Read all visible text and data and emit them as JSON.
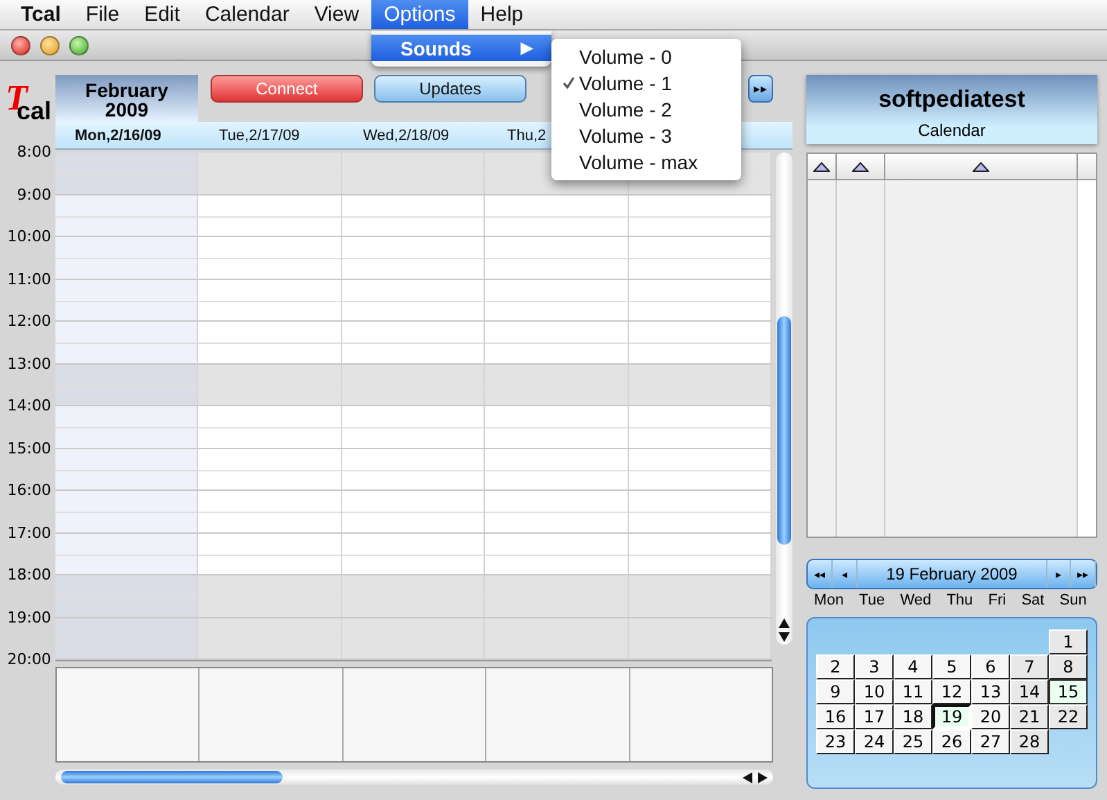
{
  "menu_bar": [
    {
      "label": "Tcal",
      "kind": "app",
      "selected": false
    },
    {
      "label": "File",
      "kind": "menu",
      "selected": false
    },
    {
      "label": "Edit",
      "kind": "menu",
      "selected": false
    },
    {
      "label": "Calendar",
      "kind": "menu",
      "selected": false
    },
    {
      "label": "View",
      "kind": "menu",
      "selected": false
    },
    {
      "label": "Options",
      "kind": "menu",
      "selected": true
    },
    {
      "label": "Help",
      "kind": "menu",
      "selected": false
    }
  ],
  "options_menu": {
    "items": [
      {
        "label": "Sounds",
        "arrow": "▶",
        "selected": true
      }
    ],
    "submenu": [
      {
        "label": "Volume - 0",
        "checked": false
      },
      {
        "label": "Volume - 1",
        "checked": true
      },
      {
        "label": "Volume - 2",
        "checked": false
      },
      {
        "label": "Volume - 3",
        "checked": false
      },
      {
        "label": "Volume - max",
        "checked": false
      }
    ]
  },
  "logo": {
    "letter": "T",
    "rest": "cal"
  },
  "month": {
    "name": "February",
    "year": "2009"
  },
  "toolbar": [
    {
      "label": "Connect",
      "kind": "red"
    },
    {
      "label": "Updates",
      "kind": "blue"
    }
  ],
  "next_button": "▸▸",
  "day_headers": [
    {
      "label": "Mon,2/16/09",
      "selected": true
    },
    {
      "label": "Tue,2/17/09",
      "selected": false
    },
    {
      "label": "Wed,2/18/09",
      "selected": false
    },
    {
      "label": "Thu,2",
      "selected": false
    }
  ],
  "hours": [
    {
      "label": "8:00",
      "shaded": true
    },
    {
      "label": "9:00",
      "shaded": false
    },
    {
      "label": "10:00",
      "shaded": false
    },
    {
      "label": "11:00",
      "shaded": false
    },
    {
      "label": "12:00",
      "shaded": false
    },
    {
      "label": "13:00",
      "shaded": true
    },
    {
      "label": "14:00",
      "shaded": false
    },
    {
      "label": "15:00",
      "shaded": false
    },
    {
      "label": "16:00",
      "shaded": false
    },
    {
      "label": "17:00",
      "shaded": false
    },
    {
      "label": "18:00",
      "shaded": true
    },
    {
      "label": "19:00",
      "shaded": true
    },
    {
      "label": "20:00"
    }
  ],
  "user": {
    "name": "softpediatest",
    "subtitle": "Calendar"
  },
  "mini_calendar": {
    "title": "19 February 2009",
    "prev_year": "◂◂",
    "prev": "◂",
    "next": "▸",
    "next_year": "▸▸",
    "weekdays": [
      "Mon",
      "Tue",
      "Wed",
      "Thu",
      "Fri",
      "Sat",
      "Sun"
    ],
    "weeks": [
      [
        {
          "day": "1",
          "selected": false,
          "today": false
        }
      ],
      [
        {
          "day": "2",
          "selected": false,
          "today": false
        },
        {
          "day": "3",
          "selected": false,
          "today": false
        },
        {
          "day": "4",
          "selected": false,
          "today": false
        },
        {
          "day": "5",
          "selected": false,
          "today": false
        },
        {
          "day": "6",
          "selected": false,
          "today": false
        },
        {
          "day": "7",
          "selected": false,
          "today": false
        },
        {
          "day": "8",
          "selected": false,
          "today": false
        }
      ],
      [
        {
          "day": "9",
          "selected": false,
          "today": false
        },
        {
          "day": "10",
          "selected": false,
          "today": false
        },
        {
          "day": "11",
          "selected": false,
          "today": false
        },
        {
          "day": "12",
          "selected": false,
          "today": false
        },
        {
          "day": "13",
          "selected": false,
          "today": false
        },
        {
          "day": "14",
          "selected": false,
          "today": false
        },
        {
          "day": "15",
          "selected": false,
          "today": true
        }
      ],
      [
        {
          "day": "16",
          "selected": false,
          "today": false
        },
        {
          "day": "17",
          "selected": false,
          "today": false
        },
        {
          "day": "18",
          "selected": false,
          "today": false
        },
        {
          "day": "19",
          "selected": true,
          "today": false
        },
        {
          "day": "20",
          "selected": false,
          "today": false
        },
        {
          "day": "21",
          "selected": false,
          "today": false
        },
        {
          "day": "22",
          "selected": false,
          "today": false
        }
      ],
      [
        {
          "day": "23",
          "selected": false,
          "today": false
        },
        {
          "day": "24",
          "selected": false,
          "today": false
        },
        {
          "day": "25",
          "selected": false,
          "today": false
        },
        {
          "day": "26",
          "selected": false,
          "today": false
        },
        {
          "day": "27",
          "selected": false,
          "today": false
        },
        {
          "day": "28",
          "selected": false,
          "today": false
        }
      ]
    ]
  }
}
